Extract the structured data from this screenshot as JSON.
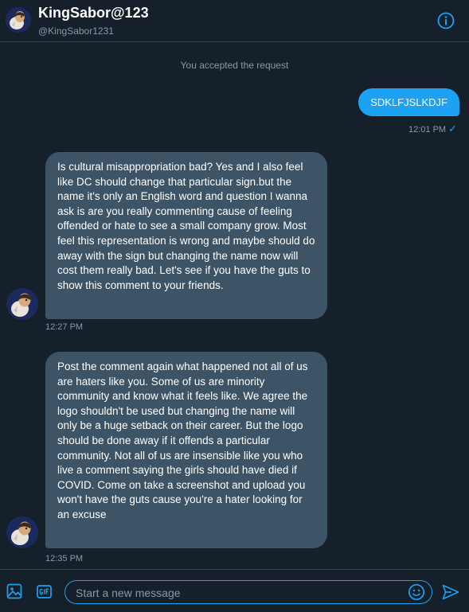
{
  "header": {
    "display_name": "KingSabor@123",
    "handle": "@KingSabor1231",
    "avatar_icon": "profile-avatar",
    "info_icon": "info-icon"
  },
  "thread": {
    "system_note": "You accepted the request",
    "messages": [
      {
        "direction": "outgoing",
        "text": "SDKLFJSLKDJF",
        "time": "12:01 PM",
        "status_icon": "checkmark-icon",
        "status_glyph": "✓"
      },
      {
        "direction": "incoming",
        "text": "Is cultural misappropriation bad? Yes and I also feel like DC should change that particular sign.but the name it's only an English word and question I wanna ask is are you really commenting cause of feeling offended or hate to see a small company grow. Most feel this representation is wrong and maybe should do away with the sign but changing the name now will cost them really bad. Let's see if you have the guts to show this comment to your friends.",
        "time": "12:27 PM"
      },
      {
        "direction": "incoming",
        "text": "Post the comment again what happened not all of us are haters like you. Some of us are minority community and know what it feels like. We agree the logo shouldn't be used but changing the name will only be a huge setback on their career. But the logo should be done away if it offends a particular community. Not all of us are insensible like you who live a comment saying the girls should have died if COVID. Come on take a screenshot and upload you won't have the guts cause you're a hater looking for an excuse",
        "time": "12:35 PM"
      }
    ]
  },
  "composer": {
    "placeholder": "Start a new message",
    "value": "",
    "media_icon": "image-icon",
    "gif_icon": "gif-icon",
    "emoji_icon": "emoji-icon",
    "send_icon": "send-icon"
  },
  "colors": {
    "background": "#15202b",
    "accent": "#1da1f2",
    "incoming_bubble": "#3d5466",
    "muted_text": "#8899a6",
    "divider": "#38444d"
  }
}
